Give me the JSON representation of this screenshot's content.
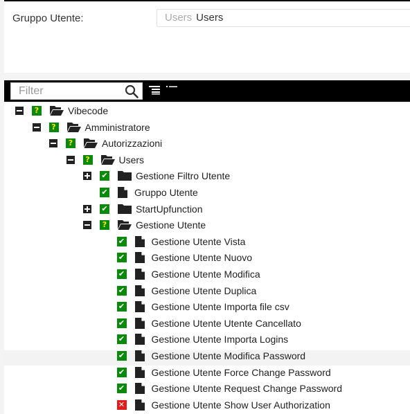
{
  "form": {
    "label": "Gruppo Utente:",
    "placeholder": "Users",
    "value": "Users"
  },
  "toolbar": {
    "filter_placeholder": "Filter",
    "search_icon": "search-icon",
    "expand_all_icon": "expand-all-icon",
    "collapse_all_icon": "collapse-all-icon"
  },
  "colors": {
    "checked": "#0a8a0a",
    "unknown_mark": "#ffe600",
    "denied": "#e21b1b",
    "toolbar_bg": "#000000"
  },
  "tree": [
    {
      "label": "Vibecode",
      "depth": 0,
      "toggle": "collapse",
      "state": "unknown",
      "icon": "folder-open"
    },
    {
      "label": "Amministratore",
      "depth": 1,
      "toggle": "collapse",
      "state": "unknown",
      "icon": "folder-open"
    },
    {
      "label": "Autorizzazioni",
      "depth": 2,
      "toggle": "collapse",
      "state": "unknown",
      "icon": "folder-open"
    },
    {
      "label": "Users",
      "depth": 3,
      "toggle": "collapse",
      "state": "unknown",
      "icon": "folder-open"
    },
    {
      "label": "Gestione Filtro Utente",
      "depth": 4,
      "toggle": "expand",
      "state": "checked",
      "icon": "folder"
    },
    {
      "label": "Gruppo Utente",
      "depth": 4,
      "toggle": "none",
      "state": "checked",
      "icon": "file"
    },
    {
      "label": "StartUpfunction",
      "depth": 4,
      "toggle": "expand",
      "state": "checked",
      "icon": "folder"
    },
    {
      "label": "Gestione Utente",
      "depth": 4,
      "toggle": "collapse",
      "state": "unknown",
      "icon": "folder-open"
    },
    {
      "label": "Gestione Utente Vista",
      "depth": 5,
      "toggle": "none",
      "state": "checked",
      "icon": "file"
    },
    {
      "label": "Gestione Utente Nuovo",
      "depth": 5,
      "toggle": "none",
      "state": "checked",
      "icon": "file"
    },
    {
      "label": "Gestione Utente Modifica",
      "depth": 5,
      "toggle": "none",
      "state": "checked",
      "icon": "file"
    },
    {
      "label": "Gestione Utente Duplica",
      "depth": 5,
      "toggle": "none",
      "state": "checked",
      "icon": "file"
    },
    {
      "label": "Gestione Utente Importa file csv",
      "depth": 5,
      "toggle": "none",
      "state": "checked",
      "icon": "file"
    },
    {
      "label": "Gestione Utente Utente Cancellato",
      "depth": 5,
      "toggle": "none",
      "state": "checked",
      "icon": "file"
    },
    {
      "label": "Gestione Utente Importa Logins",
      "depth": 5,
      "toggle": "none",
      "state": "checked",
      "icon": "file"
    },
    {
      "label": "Gestione Utente Modifica Password",
      "depth": 5,
      "toggle": "none",
      "state": "checked",
      "icon": "file"
    },
    {
      "label": "Gestione Utente Force Change Password",
      "depth": 5,
      "toggle": "none",
      "state": "checked",
      "icon": "file"
    },
    {
      "label": "Gestione Utente Request Change Password",
      "depth": 5,
      "toggle": "none",
      "state": "checked",
      "icon": "file"
    },
    {
      "label": "Gestione Utente Show User Authorization",
      "depth": 5,
      "toggle": "none",
      "state": "denied",
      "icon": "file"
    }
  ]
}
